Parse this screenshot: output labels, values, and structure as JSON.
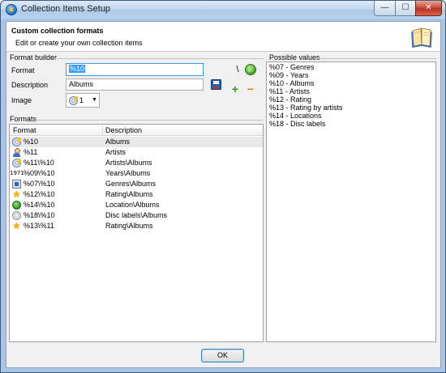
{
  "window": {
    "title": "Collection Items Setup",
    "controls": {
      "minimize": "—",
      "maximize": "☐",
      "close": "✕"
    }
  },
  "header": {
    "title": "Custom collection formats",
    "subtitle": "Edit or create your own collection items"
  },
  "format_builder": {
    "section_label": "Format builder",
    "format_label": "Format",
    "format_value": "%10",
    "description_label": "Description",
    "description_value": "Albums",
    "image_label": "Image",
    "image_value": "1",
    "backslash_symbol": "\\",
    "plus_symbol": "+",
    "minus_symbol": "−",
    "arrow_symbol": "←"
  },
  "formats": {
    "section_label": "Formats",
    "columns": [
      "Format",
      "Description"
    ],
    "rows": [
      {
        "format": "%10",
        "description": "Albums",
        "icon": "disc-icon",
        "selected": true
      },
      {
        "format": "%11",
        "description": "Artists",
        "icon": "person-icon"
      },
      {
        "format": "%11\\%10",
        "description": "Artists\\Albums",
        "icon": "disc-icon"
      },
      {
        "format": "%09\\%10",
        "description": "Years\\Albums",
        "icon": "years-icon",
        "icon_text": "1971"
      },
      {
        "format": "%07\\%10",
        "description": "Genres\\Albums",
        "icon": "genre-icon"
      },
      {
        "format": "%12\\%10",
        "description": "Rating\\Albums",
        "icon": "star-icon"
      },
      {
        "format": "%14\\%10",
        "description": "Location\\Albums",
        "icon": "location-icon"
      },
      {
        "format": "%18\\%10",
        "description": "Disc labels\\Albums",
        "icon": "disc-label-icon"
      },
      {
        "format": "%13\\%11",
        "description": "Rating\\Albums",
        "icon": "star-icon"
      }
    ]
  },
  "possible_values": {
    "section_label": "Possible values",
    "items": [
      "%07 - Genres",
      "%09 - Years",
      "%10 - Albums",
      "%11 - Artists",
      "%12 - Rating",
      "%13 - Rating by artists",
      "%14 - Locations",
      "%18 - Disc labels"
    ]
  },
  "footer": {
    "ok_label": "OK"
  }
}
